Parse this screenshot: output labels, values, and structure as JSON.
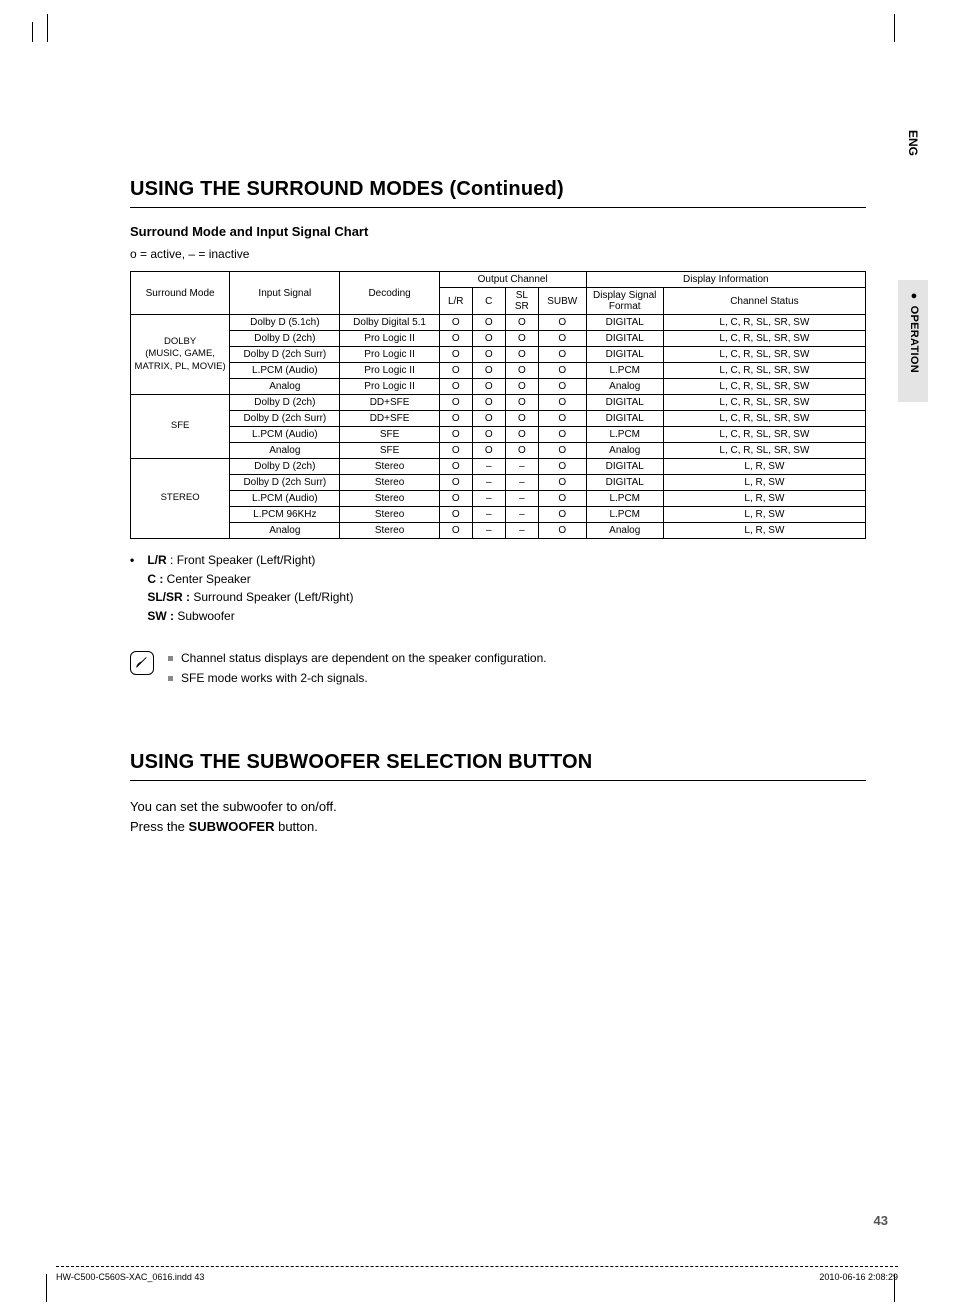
{
  "side": {
    "lang": "ENG",
    "section_label": "●  OPERATION"
  },
  "heading1": "USING THE SURROUND MODES (Continued)",
  "sub1": "Surround Mode and Input Signal Chart",
  "legend_small": "o = active,  – = inactive",
  "table": {
    "headers": {
      "surround_mode": "Surround Mode",
      "input_signal": "Input Signal",
      "decoding": "Decoding",
      "output_channel": "Output Channel",
      "display_information": "Display Information",
      "lr": "L/R",
      "c": "C",
      "slsr": "SL\nSR",
      "subw": "SUBW",
      "dsf": "Display Signal\nFormat",
      "channel_status": "Channel Status"
    },
    "groups": [
      {
        "mode": "DOLBY\n(MUSIC, GAME,\nMATRIX, PL, MOVIE)",
        "rows": [
          {
            "input": "Dolby D (5.1ch)",
            "decoding": "Dolby Digital 5.1",
            "lr": "O",
            "c": "O",
            "slsr": "O",
            "subw": "O",
            "dsf": "DIGITAL",
            "cs": "L, C, R, SL, SR, SW"
          },
          {
            "input": "Dolby D (2ch)",
            "decoding": "Pro Logic II",
            "lr": "O",
            "c": "O",
            "slsr": "O",
            "subw": "O",
            "dsf": "DIGITAL",
            "cs": "L, C, R, SL, SR, SW"
          },
          {
            "input": "Dolby D (2ch Surr)",
            "decoding": "Pro Logic II",
            "lr": "O",
            "c": "O",
            "slsr": "O",
            "subw": "O",
            "dsf": "DIGITAL",
            "cs": "L, C, R, SL, SR, SW"
          },
          {
            "input": "L.PCM (Audio)",
            "decoding": "Pro Logic II",
            "lr": "O",
            "c": "O",
            "slsr": "O",
            "subw": "O",
            "dsf": "L.PCM",
            "cs": "L, C, R, SL, SR, SW"
          },
          {
            "input": "Analog",
            "decoding": "Pro Logic II",
            "lr": "O",
            "c": "O",
            "slsr": "O",
            "subw": "O",
            "dsf": "Analog",
            "cs": "L, C, R, SL, SR, SW"
          }
        ]
      },
      {
        "mode": "SFE",
        "rows": [
          {
            "input": "Dolby D (2ch)",
            "decoding": "DD+SFE",
            "lr": "O",
            "c": "O",
            "slsr": "O",
            "subw": "O",
            "dsf": "DIGITAL",
            "cs": "L, C, R, SL, SR, SW"
          },
          {
            "input": "Dolby D (2ch Surr)",
            "decoding": "DD+SFE",
            "lr": "O",
            "c": "O",
            "slsr": "O",
            "subw": "O",
            "dsf": "DIGITAL",
            "cs": "L, C, R, SL, SR, SW"
          },
          {
            "input": "L.PCM (Audio)",
            "decoding": "SFE",
            "lr": "O",
            "c": "O",
            "slsr": "O",
            "subw": "O",
            "dsf": "L.PCM",
            "cs": "L, C, R, SL, SR, SW"
          },
          {
            "input": "Analog",
            "decoding": "SFE",
            "lr": "O",
            "c": "O",
            "slsr": "O",
            "subw": "O",
            "dsf": "Analog",
            "cs": "L, C, R, SL, SR, SW"
          }
        ]
      },
      {
        "mode": "STEREO",
        "rows": [
          {
            "input": "Dolby D (2ch)",
            "decoding": "Stereo",
            "lr": "O",
            "c": "–",
            "slsr": "–",
            "subw": "O",
            "dsf": "DIGITAL",
            "cs": "L, R, SW"
          },
          {
            "input": "Dolby D (2ch Surr)",
            "decoding": "Stereo",
            "lr": "O",
            "c": "–",
            "slsr": "–",
            "subw": "O",
            "dsf": "DIGITAL",
            "cs": "L, R, SW"
          },
          {
            "input": "L.PCM (Audio)",
            "decoding": "Stereo",
            "lr": "O",
            "c": "–",
            "slsr": "–",
            "subw": "O",
            "dsf": "L.PCM",
            "cs": "L, R, SW"
          },
          {
            "input": "L.PCM 96KHz",
            "decoding": "Stereo",
            "lr": "O",
            "c": "–",
            "slsr": "–",
            "subw": "O",
            "dsf": "L.PCM",
            "cs": "L, R, SW"
          },
          {
            "input": "Analog",
            "decoding": "Stereo",
            "lr": "O",
            "c": "–",
            "slsr": "–",
            "subw": "O",
            "dsf": "Analog",
            "cs": "L, R, SW"
          }
        ]
      }
    ]
  },
  "speaker_legend": {
    "lr_label": "L/R",
    "lr_text": ": Front Speaker (Left/Right)",
    "c_label": "C :",
    "c_text": " Center Speaker",
    "slsr_label": "SL/SR :",
    "slsr_text": " Surround Speaker (Left/Right)",
    "sw_label": "SW :",
    "sw_text": " Subwoofer"
  },
  "notes": {
    "n1": "Channel status displays are dependent on the speaker configuration.",
    "n2": "SFE mode works with 2-ch signals."
  },
  "heading2": "USING THE SUBWOOFER SELECTION BUTTON",
  "body2a": "You can set the subwoofer to on/off.",
  "body2b_prefix": "Press the ",
  "body2b_bold": "SUBWOOFER",
  "body2b_suffix": " button.",
  "page_number": "43",
  "footer_left": "HW-C500-C560S-XAC_0616.indd   43",
  "footer_right": "2010-06-16    2:08:29"
}
